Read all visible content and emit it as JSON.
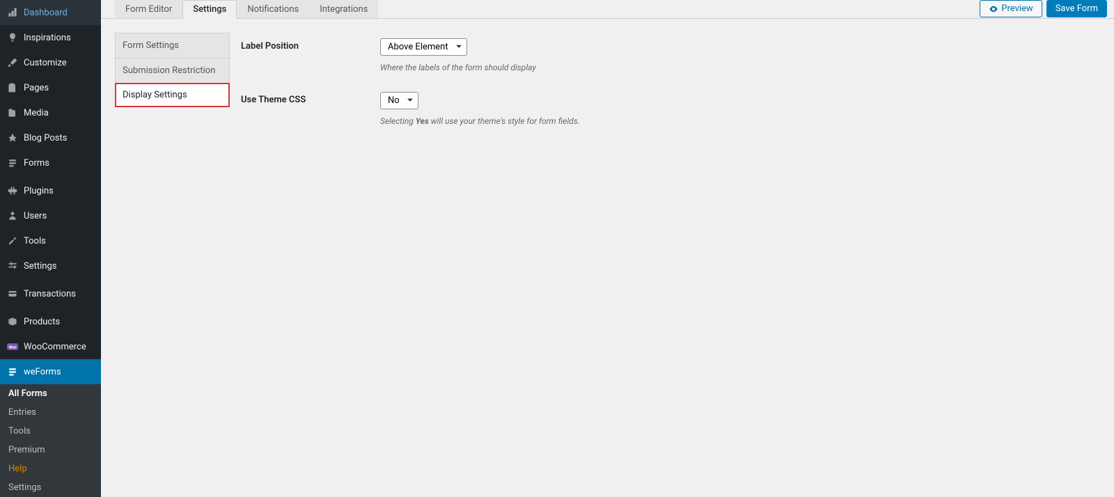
{
  "sidebar": {
    "items": [
      {
        "label": "Dashboard",
        "icon": "dashboard"
      },
      {
        "label": "Inspirations",
        "icon": "lightbulb"
      },
      {
        "label": "Customize",
        "icon": "brush"
      },
      {
        "label": "Pages",
        "icon": "pages"
      },
      {
        "label": "Media",
        "icon": "media"
      },
      {
        "label": "Blog Posts",
        "icon": "pin"
      },
      {
        "label": "Forms",
        "icon": "form"
      }
    ],
    "items2": [
      {
        "label": "Plugins",
        "icon": "plug"
      },
      {
        "label": "Users",
        "icon": "user"
      },
      {
        "label": "Tools",
        "icon": "wrench"
      },
      {
        "label": "Settings",
        "icon": "sliders"
      }
    ],
    "items3": [
      {
        "label": "Transactions",
        "icon": "transactions"
      }
    ],
    "items4": [
      {
        "label": "Products",
        "icon": "box"
      },
      {
        "label": "WooCommerce",
        "icon": "woo"
      },
      {
        "label": "weForms",
        "icon": "weforms",
        "active": true
      }
    ],
    "submenu": [
      {
        "label": "All Forms",
        "current": true
      },
      {
        "label": "Entries"
      },
      {
        "label": "Tools"
      },
      {
        "label": "Premium"
      },
      {
        "label": "Help",
        "help": true
      },
      {
        "label": "Settings"
      }
    ]
  },
  "topTabs": {
    "items": [
      {
        "label": "Form Editor"
      },
      {
        "label": "Settings",
        "active": true
      },
      {
        "label": "Notifications"
      },
      {
        "label": "Integrations"
      }
    ]
  },
  "actions": {
    "preview": "Preview",
    "save": "Save Form"
  },
  "subtabs": {
    "items": [
      {
        "label": "Form Settings"
      },
      {
        "label": "Submission Restriction"
      },
      {
        "label": "Display Settings",
        "highlighted": true
      }
    ]
  },
  "settings": {
    "labelPosition": {
      "label": "Label Position",
      "value": "Above Element",
      "hint": "Where the labels of the form should display"
    },
    "useThemeCss": {
      "label": "Use Theme CSS",
      "value": "No",
      "hintPrefix": "Selecting ",
      "hintBold": "Yes",
      "hintSuffix": " will use your theme's style for form fields."
    }
  }
}
